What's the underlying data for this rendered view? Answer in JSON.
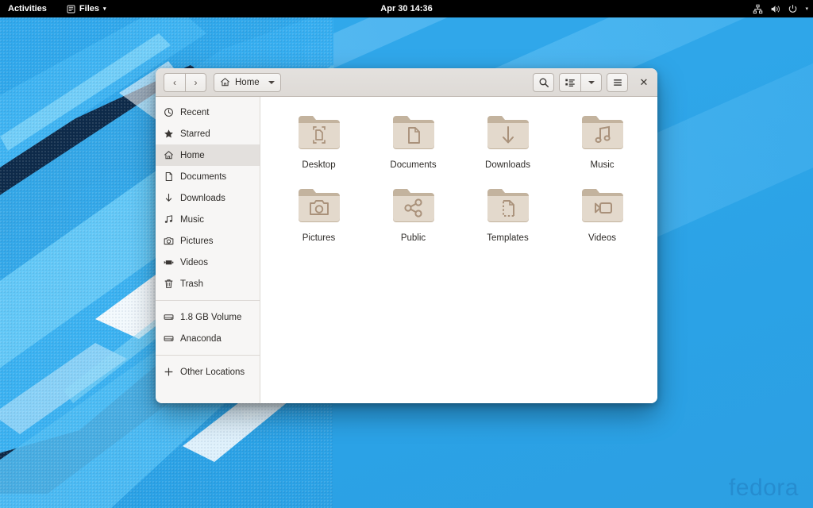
{
  "topbar": {
    "activities": "Activities",
    "app_menu": {
      "label": "Files",
      "icon": "files-app-icon",
      "arrow": "▾"
    },
    "clock": "Apr 30  14:36",
    "tray": [
      {
        "name": "network-wired-icon"
      },
      {
        "name": "volume-icon"
      },
      {
        "name": "power-icon"
      },
      {
        "name": "chevron-down-icon"
      }
    ]
  },
  "window": {
    "headerbar": {
      "back": "‹",
      "forward": "›",
      "path_label": "Home",
      "path_icon": "home-icon",
      "search_icon": "search-icon",
      "view_icon": "list-view-icon",
      "view_arrow": "▾",
      "menu_icon": "hamburger-menu-icon",
      "close_label": "✕"
    },
    "sidebar": {
      "groups": [
        {
          "items": [
            {
              "label": "Recent",
              "icon": "clock-icon",
              "selected": false
            },
            {
              "label": "Starred",
              "icon": "star-icon",
              "selected": false
            },
            {
              "label": "Home",
              "icon": "home-icon",
              "selected": true
            },
            {
              "label": "Documents",
              "icon": "document-icon",
              "selected": false
            },
            {
              "label": "Downloads",
              "icon": "download-icon",
              "selected": false
            },
            {
              "label": "Music",
              "icon": "music-icon",
              "selected": false
            },
            {
              "label": "Pictures",
              "icon": "camera-icon",
              "selected": false
            },
            {
              "label": "Videos",
              "icon": "video-icon",
              "selected": false
            },
            {
              "label": "Trash",
              "icon": "trash-icon",
              "selected": false
            }
          ]
        },
        {
          "items": [
            {
              "label": "1.8 GB Volume",
              "icon": "drive-icon",
              "selected": false
            },
            {
              "label": "Anaconda",
              "icon": "drive-icon",
              "selected": false
            }
          ]
        },
        {
          "items": [
            {
              "label": "Other Locations",
              "icon": "plus-icon",
              "selected": false
            }
          ]
        }
      ]
    },
    "files": [
      {
        "name": "Desktop",
        "emblem": "desktop-emblem"
      },
      {
        "name": "Documents",
        "emblem": "document-emblem"
      },
      {
        "name": "Downloads",
        "emblem": "download-emblem"
      },
      {
        "name": "Music",
        "emblem": "music-emblem"
      },
      {
        "name": "Pictures",
        "emblem": "camera-emblem"
      },
      {
        "name": "Public",
        "emblem": "share-emblem"
      },
      {
        "name": "Templates",
        "emblem": "template-emblem"
      },
      {
        "name": "Videos",
        "emblem": "video-emblem"
      }
    ]
  },
  "desktop": {
    "watermark": "fedora"
  },
  "colors": {
    "wallpaper_blue": "#2ea7ea",
    "wallpaper_dark": "#0d2845",
    "folder_body": "#e0d5c6",
    "folder_tab": "#c3b39e",
    "folder_emblem": "#a9917a",
    "topbar_bg": "#000000",
    "headerbar_bg": "#e1ded9",
    "sidebar_bg": "#f7f6f5",
    "selection_bg": "#e3e0dd"
  }
}
